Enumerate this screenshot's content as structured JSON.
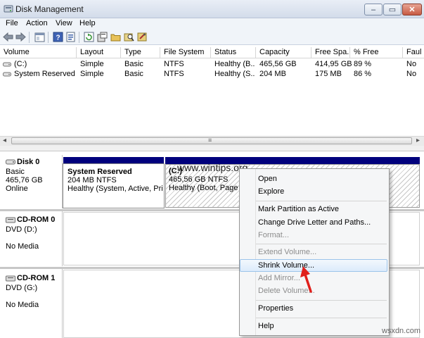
{
  "window": {
    "title": "Disk Management",
    "min_glyph": "–",
    "max_glyph": "▭",
    "close_glyph": "✕"
  },
  "menu": [
    "File",
    "Action",
    "View",
    "Help"
  ],
  "volume_table": {
    "headers": [
      "Volume",
      "Layout",
      "Type",
      "File System",
      "Status",
      "Capacity",
      "Free Spa...",
      "% Free",
      "Faul"
    ],
    "rows": [
      [
        "(C:)",
        "Simple",
        "Basic",
        "NTFS",
        "Healthy (B...",
        "465,56 GB",
        "414,95 GB",
        "89 %",
        "No"
      ],
      [
        "System Reserved",
        "Simple",
        "Basic",
        "NTFS",
        "Healthy (S...",
        "204 MB",
        "175 MB",
        "86 %",
        "No"
      ]
    ]
  },
  "scroll": {
    "left": "◂",
    "right": "▸",
    "grip": "≡"
  },
  "disks": [
    {
      "name": "Disk 0",
      "lines": [
        "Basic",
        "465,76 GB",
        "Online"
      ]
    },
    {
      "name": "CD-ROM 0",
      "lines": [
        "DVD (D:)",
        "",
        "No Media"
      ]
    },
    {
      "name": "CD-ROM 1",
      "lines": [
        "DVD (G:)",
        "",
        "No Media"
      ]
    }
  ],
  "partitions": {
    "system_reserved": {
      "name": "System Reserved",
      "fs": "204 MB NTFS",
      "status": "Healthy (System, Active, Prima"
    },
    "c_drive": {
      "name": "(C:)",
      "fs": "465,56 GB NTFS",
      "status": "Healthy (Boot, Page Fi"
    }
  },
  "watermark": "www.wintips.org",
  "footer_watermark": "wsxdn.com",
  "context_menu": {
    "open": "Open",
    "explore": "Explore",
    "mark_active": "Mark Partition as Active",
    "change_letter": "Change Drive Letter and Paths...",
    "format": "Format...",
    "extend": "Extend Volume...",
    "shrink": "Shrink Volume...",
    "add_mirror": "Add Mirror...",
    "delete": "Delete Volume...",
    "properties": "Properties",
    "help": "Help"
  },
  "colors": {
    "partition_header": "#00007c",
    "highlight_border": "#9cc4ea",
    "arrow": "#e0201c"
  }
}
